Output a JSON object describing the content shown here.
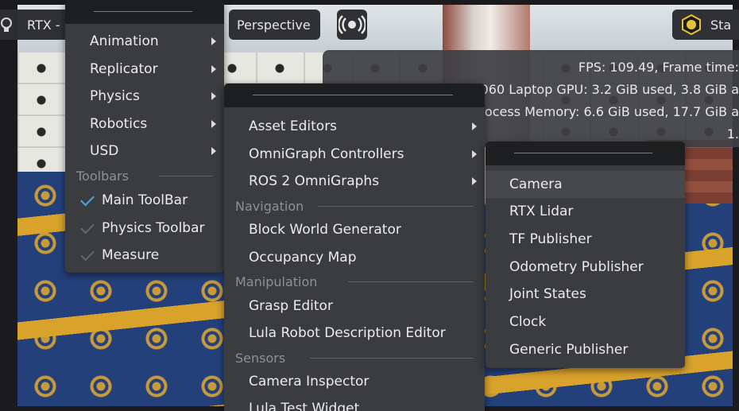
{
  "toolbar": {
    "rtx_label": "RTX -",
    "perspective_label": "Perspective",
    "stage_label": "Sta"
  },
  "stats": {
    "fps_line": "FPS: 109.49, Frame time:",
    "gpu_line": "060 Laptop GPU: 3.2 GiB used, 3.8 GiB a",
    "process_line": "ocess Memory: 6.6 GiB used, 17.7 GiB a",
    "fourth_line": "1."
  },
  "menu1": {
    "items": [
      "Animation",
      "Replicator",
      "Physics",
      "Robotics",
      "USD"
    ],
    "section_toolbars": "Toolbars",
    "toggles": [
      {
        "label": "Main ToolBar",
        "checked": true
      },
      {
        "label": "Physics Toolbar",
        "checked": false
      },
      {
        "label": "Measure",
        "checked": false
      }
    ]
  },
  "menu2": {
    "items_top": [
      "Asset Editors",
      "OmniGraph Controllers",
      "ROS 2 OmniGraphs"
    ],
    "section_navigation": "Navigation",
    "navigation_items": [
      "Block World Generator",
      "Occupancy Map"
    ],
    "section_manipulation": "Manipulation",
    "manipulation_items": [
      "Grasp Editor",
      "Lula Robot Description Editor"
    ],
    "section_sensors": "Sensors",
    "sensors_items": [
      "Camera Inspector",
      "Lula Test Widget"
    ]
  },
  "menu3": {
    "items": [
      "Camera",
      "RTX Lidar",
      "TF Publisher",
      "Odometry Publisher",
      "Joint States",
      "Clock",
      "Generic Publisher"
    ],
    "highlighted": "Camera"
  },
  "colors": {
    "menu_bg": "#3a3c3f",
    "menu_header": "#1e1f21",
    "check_active": "#44a8e6",
    "stage_icon": "#e8c23a"
  },
  "icons": [
    "lightbulb-icon",
    "broadcast-icon",
    "stage-light-icon",
    "chevron-right-icon",
    "check-icon"
  ]
}
